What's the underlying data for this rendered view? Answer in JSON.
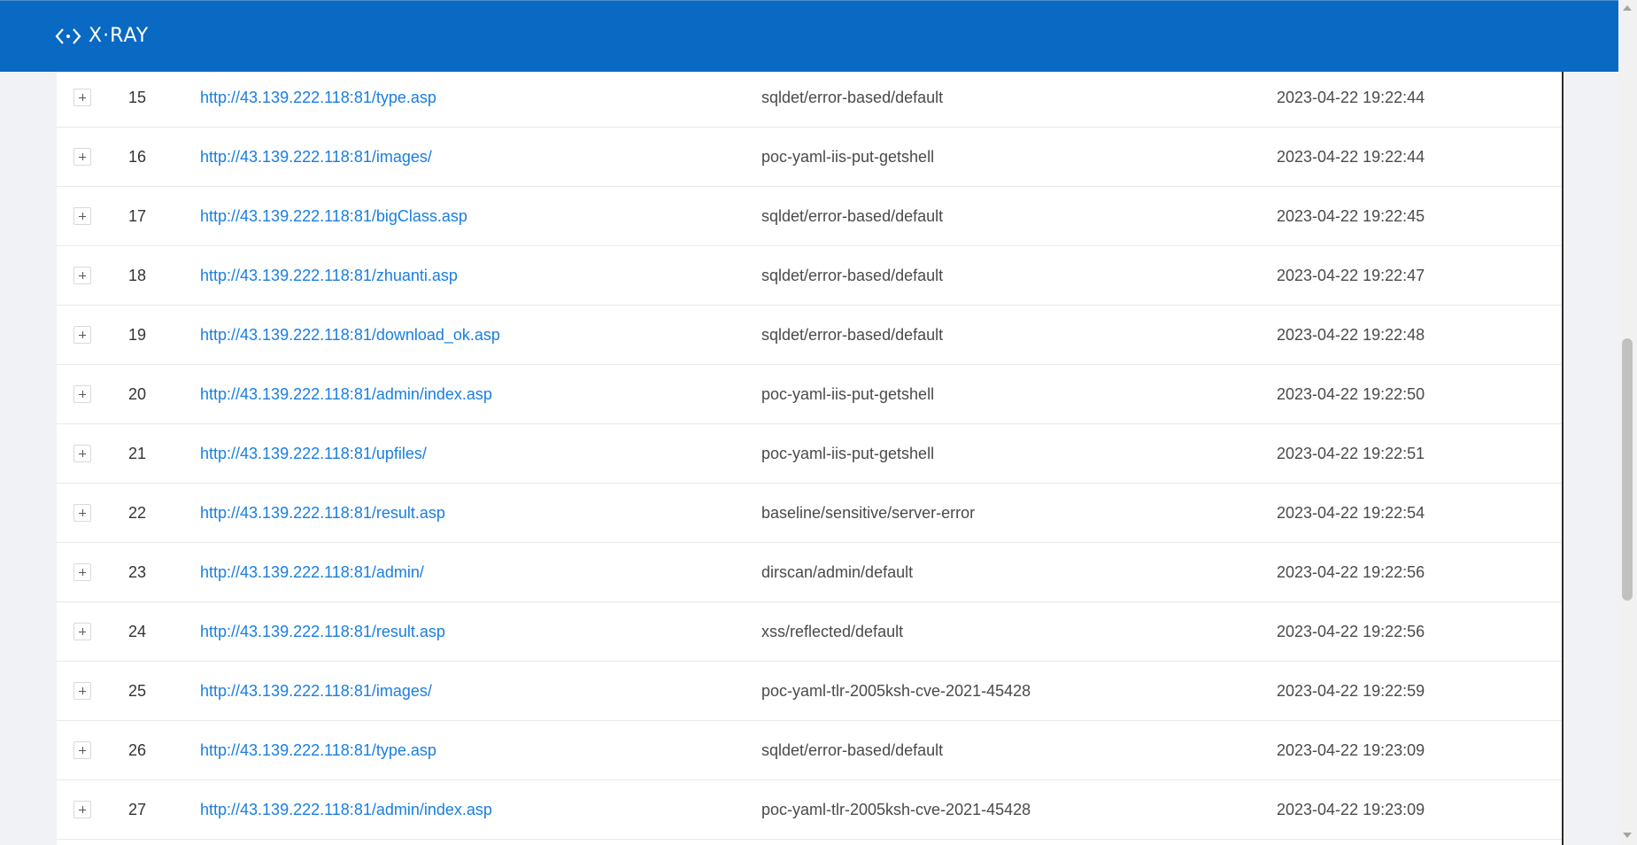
{
  "header": {
    "logo_text": "X·RAY",
    "logo_icon": "code-brackets-icon",
    "background": "#0969c3"
  },
  "table": {
    "rows": [
      {
        "id": "15",
        "url": "http://43.139.222.118:81/type.asp",
        "plugin": "sqldet/error-based/default",
        "time": "2023-04-22 19:22:44"
      },
      {
        "id": "16",
        "url": "http://43.139.222.118:81/images/",
        "plugin": "poc-yaml-iis-put-getshell",
        "time": "2023-04-22 19:22:44"
      },
      {
        "id": "17",
        "url": "http://43.139.222.118:81/bigClass.asp",
        "plugin": "sqldet/error-based/default",
        "time": "2023-04-22 19:22:45"
      },
      {
        "id": "18",
        "url": "http://43.139.222.118:81/zhuanti.asp",
        "plugin": "sqldet/error-based/default",
        "time": "2023-04-22 19:22:47"
      },
      {
        "id": "19",
        "url": "http://43.139.222.118:81/download_ok.asp",
        "plugin": "sqldet/error-based/default",
        "time": "2023-04-22 19:22:48"
      },
      {
        "id": "20",
        "url": "http://43.139.222.118:81/admin/index.asp",
        "plugin": "poc-yaml-iis-put-getshell",
        "time": "2023-04-22 19:22:50"
      },
      {
        "id": "21",
        "url": "http://43.139.222.118:81/upfiles/",
        "plugin": "poc-yaml-iis-put-getshell",
        "time": "2023-04-22 19:22:51"
      },
      {
        "id": "22",
        "url": "http://43.139.222.118:81/result.asp",
        "plugin": "baseline/sensitive/server-error",
        "time": "2023-04-22 19:22:54"
      },
      {
        "id": "23",
        "url": "http://43.139.222.118:81/admin/",
        "plugin": "dirscan/admin/default",
        "time": "2023-04-22 19:22:56"
      },
      {
        "id": "24",
        "url": "http://43.139.222.118:81/result.asp",
        "plugin": "xss/reflected/default",
        "time": "2023-04-22 19:22:56"
      },
      {
        "id": "25",
        "url": "http://43.139.222.118:81/images/",
        "plugin": "poc-yaml-tlr-2005ksh-cve-2021-45428",
        "time": "2023-04-22 19:22:59"
      },
      {
        "id": "26",
        "url": "http://43.139.222.118:81/type.asp",
        "plugin": "sqldet/error-based/default",
        "time": "2023-04-22 19:23:09"
      },
      {
        "id": "27",
        "url": "http://43.139.222.118:81/admin/index.asp",
        "plugin": "poc-yaml-tlr-2005ksh-cve-2021-45428",
        "time": "2023-04-22 19:23:09"
      }
    ]
  },
  "colors": {
    "link": "#1a7ee0",
    "text": "#4a4a4a",
    "row_border": "#e8e8e8"
  }
}
